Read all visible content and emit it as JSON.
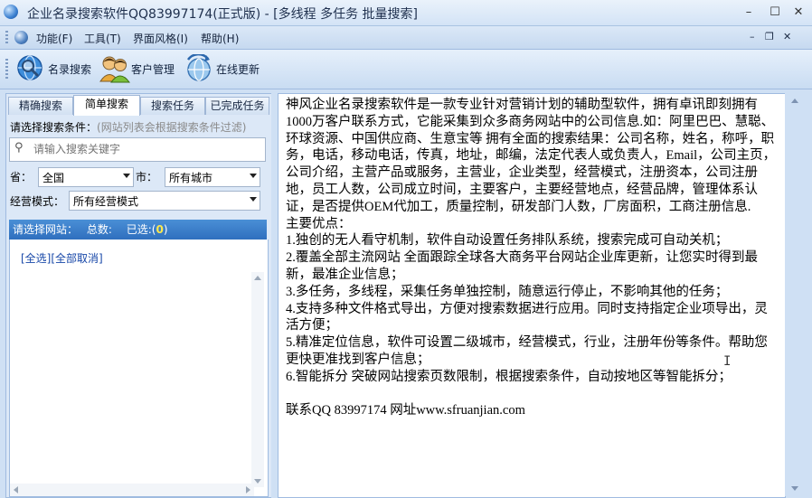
{
  "window": {
    "title": "企业名录搜索软件QQ83997174(正式版) - [多线程 多任务 批量搜索]",
    "minimize_glyph": "–",
    "maximize_glyph": "☐",
    "close_glyph": "✕"
  },
  "menu": {
    "items": [
      {
        "label": "功能(F)"
      },
      {
        "label": "工具(T)"
      },
      {
        "label": "界面风格(I)"
      },
      {
        "label": "帮助(H)"
      }
    ],
    "mdi_minimize": "–",
    "mdi_restore": "❐",
    "mdi_close": "✕"
  },
  "toolbar": {
    "buttons": [
      {
        "label": "名录搜索",
        "icon": "search-globe-icon"
      },
      {
        "label": "客户管理",
        "icon": "users-icon"
      },
      {
        "label": "在线更新",
        "icon": "update-globe-icon"
      }
    ]
  },
  "left": {
    "tabs": [
      {
        "label": "精确搜索"
      },
      {
        "label": "简单搜索",
        "active": true
      },
      {
        "label": "搜索任务"
      },
      {
        "label": "已完成任务"
      }
    ],
    "condition_label": "请选择搜索条件：",
    "condition_hint": "(网站列表会根据搜索条件过滤)",
    "search_icon": "search-icon",
    "search": {
      "value": "",
      "placeholder": "请输入搜索关键字"
    },
    "province_label": "省：",
    "province_value": "全国",
    "city_label": "市：",
    "city_value": "所有城市",
    "mode_label": "经营模式：",
    "mode_value": "所有经营模式",
    "site_header_prefix": "请选择网站：",
    "site_total_label": "总数:",
    "site_selected_label": "已选:(",
    "site_selected_count": "0",
    "site_selected_close": ")",
    "select_all": "[全选]",
    "deselect_all": "[全部取消]"
  },
  "content": {
    "paragraphs": [
      "神风企业名录搜索软件是一款专业针对营销计划的辅助型软件，拥有卓讯即刻拥有1000万客户联系方式，它能采集到众多商务网站中的公司信息.如：阿里巴巴、慧聪、环球资源、中国供应商、生意宝等  拥有全面的搜索结果：公司名称，姓名，称呼，职务，电话，移动电话，传真，地址，邮编，法定代表人或负责人，Email，公司主页，公司介绍，主营产品或服务，主营业，企业类型，经营模式，注册资本，公司注册地，员工人数，公司成立时间，主要客户，主要经营地点，经营品牌，管理体系认证，是否提供OEM代加工，质量控制，研发部门人数，厂房面积，工商注册信息.",
      "主要优点：",
      "1.独创的无人看守机制，软件自动设置任务排队系统，搜索完成可自动关机；",
      "2.覆盖全部主流网站  全面跟踪全球各大商务平台网站企业库更新，让您实时得到最新，最准企业信息；",
      "3.多任务，多线程，采集任务单独控制，随意运行停止，不影响其他的任务；",
      "4.支持多种文件格式导出，方便对搜索数据进行应用。同时支持指定企业项导出，灵活方便；",
      "5.精准定位信息，软件可设置二级城市，经营模式，行业，注册年份等条件。帮助您更快更准找到客户信息；",
      "6.智能拆分  突破网站搜索页数限制，根据搜索条件，自动按地区等智能拆分；",
      "",
      "联系QQ 83997174 网址www.sfruanjian.com"
    ]
  },
  "colors": {
    "accent": "#2f6fbe",
    "selected_count": "#ffe94a",
    "link": "#1747a8"
  }
}
